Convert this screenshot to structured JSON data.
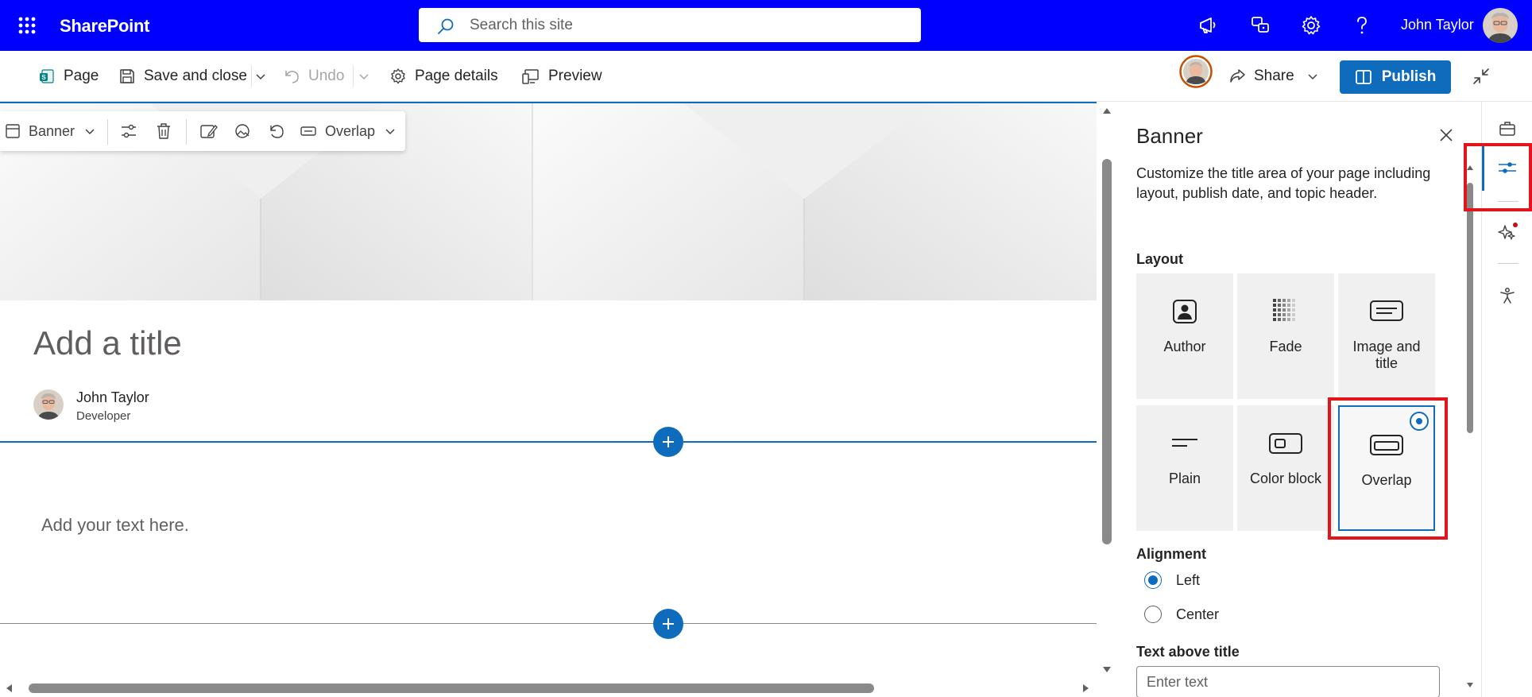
{
  "suitebar": {
    "brand": "SharePoint",
    "search_placeholder": "Search this site",
    "user_name": "John Taylor",
    "icons": [
      "app-launcher-icon",
      "megaphone-icon",
      "chat-icon",
      "gear-icon",
      "help-icon"
    ]
  },
  "commandbar": {
    "page_label": "Page",
    "save_label": "Save and close",
    "undo_label": "Undo",
    "page_details_label": "Page details",
    "preview_label": "Preview",
    "share_label": "Share",
    "publish_label": "Publish"
  },
  "webpart_toolbar": {
    "banner_label": "Banner",
    "layout_label": "Overlap"
  },
  "canvas": {
    "title_placeholder": "Add a title",
    "author_name": "John Taylor",
    "author_role": "Developer",
    "text_placeholder": "Add your text here."
  },
  "pane": {
    "title": "Banner",
    "description": "Customize the title area of your page including layout, publish date, and topic header.",
    "layout_heading": "Layout",
    "layouts": [
      {
        "label": "Author",
        "selected": false
      },
      {
        "label": "Fade",
        "selected": false
      },
      {
        "label": "Image and title",
        "selected": false
      },
      {
        "label": "Plain",
        "selected": false
      },
      {
        "label": "Color block",
        "selected": false
      },
      {
        "label": "Overlap",
        "selected": true
      }
    ],
    "alignment_heading": "Alignment",
    "alignment_options": [
      {
        "label": "Left",
        "checked": true
      },
      {
        "label": "Center",
        "checked": false
      }
    ],
    "text_above_title_heading": "Text above title",
    "text_above_title_placeholder": "Enter text"
  },
  "colors": {
    "suitebar": "#0000ff",
    "accent": "#0f6cbd",
    "highlight": "#e3141c"
  }
}
